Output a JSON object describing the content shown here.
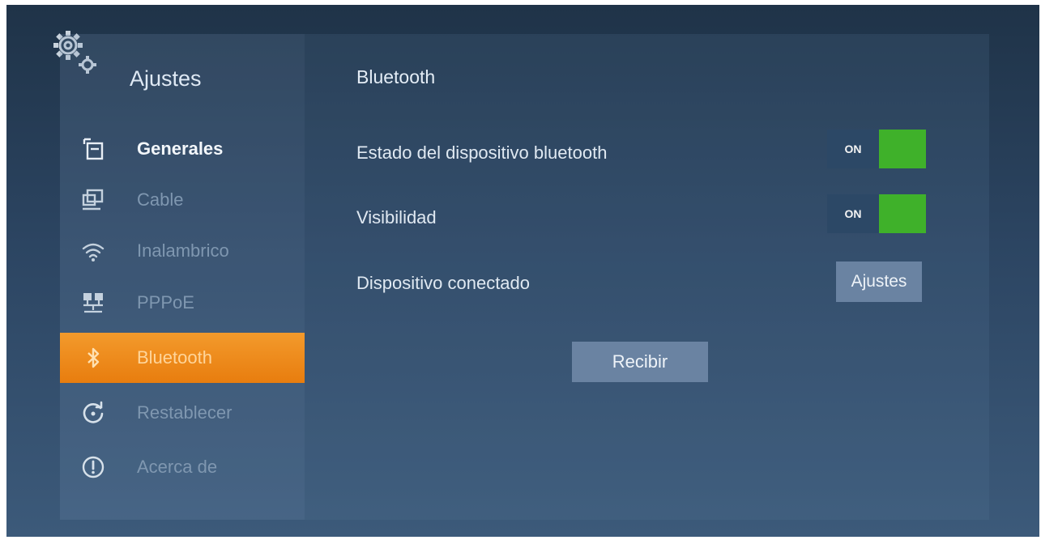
{
  "sidebar": {
    "title": "Ajustes",
    "items": [
      {
        "label": "Generales",
        "icon": "document-icon"
      },
      {
        "label": "Cable",
        "icon": "monitor-icon"
      },
      {
        "label": "Inalambrico",
        "icon": "wifi-icon"
      },
      {
        "label": "PPPoE",
        "icon": "network-icon"
      },
      {
        "label": "Bluetooth",
        "icon": "bluetooth-icon"
      },
      {
        "label": "Restablecer",
        "icon": "reset-icon"
      },
      {
        "label": "Acerca de",
        "icon": "info-icon"
      }
    ],
    "active_item": "Bluetooth"
  },
  "main": {
    "title": "Bluetooth",
    "rows": [
      {
        "label": "Estado del dispositivo bluetooth",
        "toggle_text": "ON"
      },
      {
        "label": "Visibilidad",
        "toggle_text": "ON"
      },
      {
        "label": "Dispositivo conectado",
        "button_label": "Ajustes"
      }
    ],
    "receive_button": "Recibir"
  },
  "colors": {
    "accent_orange": "#f08c1e",
    "toggle_on_green": "#3fb12a",
    "button_gray_blue": "#6a83a2"
  }
}
